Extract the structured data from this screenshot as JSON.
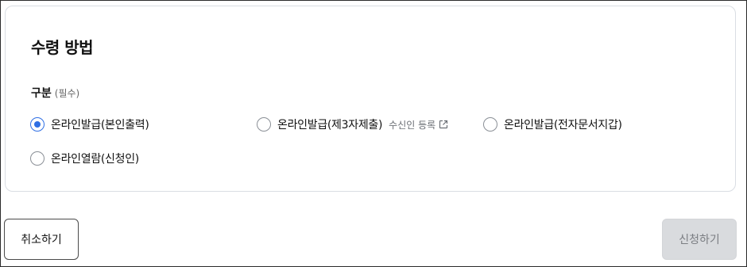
{
  "section": {
    "title": "수령 방법"
  },
  "field": {
    "label": "구분",
    "required_hint": "(필수)"
  },
  "options": [
    {
      "label": "온라인발급(본인출력)",
      "checked": true
    },
    {
      "label": "온라인발급(제3자제출)",
      "checked": false,
      "link_label": "수신인 등록",
      "link_icon": "external-link-icon"
    },
    {
      "label": "온라인발급(전자문서지갑)",
      "checked": false
    },
    {
      "label": "온라인열람(신청인)",
      "checked": false
    }
  ],
  "actions": {
    "cancel_label": "취소하기",
    "submit_label": "신청하기",
    "submit_disabled": true
  },
  "colors": {
    "accent": "#2f6fe4",
    "border": "#d9dde3",
    "disabled_bg": "#d9dbde"
  }
}
